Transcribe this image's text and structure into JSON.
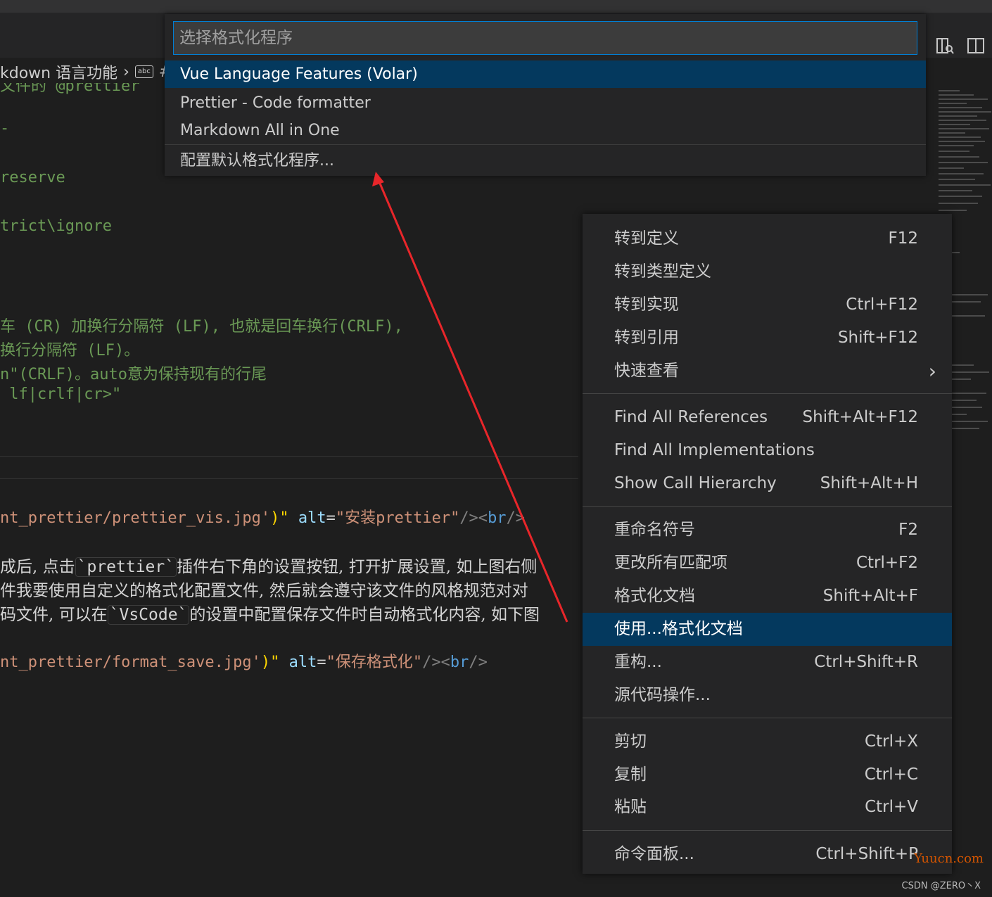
{
  "breadcrumb": {
    "item": "kdown 语言功能",
    "abc_badge": "abc",
    "hash": "#"
  },
  "editor": {
    "lines": [
      {
        "text": "文件的 @prettier",
        "cls": "green"
      },
      {
        "text": "-",
        "cls": "green"
      },
      {
        "text": "reserve",
        "cls": "green"
      },
      {
        "text": "trict\\ignore",
        "cls": "green"
      },
      {
        "text": "车 (CR) 加换行分隔符 (LF), 也就是回车换行(CRLF),",
        "cls": "green"
      },
      {
        "text": "换行分隔符 (LF)。",
        "cls": "green"
      },
      {
        "text": "n\"(CRLF)。auto意为保持现有的行尾",
        "cls": "green"
      },
      {
        "text": " lf|crlf|cr>\"",
        "cls": "green"
      }
    ],
    "img1": {
      "path": "nt_prettier/prettier_vis.jpg'",
      "close": ")\"",
      "attr": "alt",
      "eq": "=",
      "val": "\"安装prettier\"",
      "tail_open": "/><",
      "br": "br",
      "tail_close": "/>"
    },
    "prose1": {
      "a": "成后, 点击",
      "code1": "`prettier`",
      "b": "插件右下角的设置按钮, 打开扩展设置, 如上图右侧"
    },
    "prose2": "件我要使用自定义的格式化配置文件, 然后就会遵守该文件的风格规范对对",
    "prose3": {
      "a": "码文件, 可以在",
      "code2": "`VsCode`",
      "b": "的设置中配置保存文件时自动格式化内容, 如下图"
    },
    "img2": {
      "path": "nt_prettier/format_save.jpg'",
      "close": ")\"",
      "attr": "alt",
      "eq": "=",
      "val": "\"保存格式化\"",
      "tail_open": "/><",
      "br": "br",
      "tail_close": "/>"
    }
  },
  "quick_pick": {
    "placeholder": "选择格式化程序",
    "items": [
      {
        "label": "Vue Language Features (Volar)",
        "selected": true
      },
      {
        "label": "Prettier - Code formatter",
        "selected": false
      },
      {
        "label": "Markdown All in One",
        "selected": false
      },
      {
        "label": "配置默认格式化程序...",
        "selected": false
      }
    ]
  },
  "context_menu": {
    "items": [
      {
        "label": "转到定义",
        "key": "F12"
      },
      {
        "label": "转到类型定义",
        "key": ""
      },
      {
        "label": "转到实现",
        "key": "Ctrl+F12"
      },
      {
        "label": "转到引用",
        "key": "Shift+F12"
      },
      {
        "label": "快速查看",
        "key": "›"
      },
      {
        "label": "Find All References",
        "key": "Shift+Alt+F12"
      },
      {
        "label": "Find All Implementations",
        "key": ""
      },
      {
        "label": "Show Call Hierarchy",
        "key": "Shift+Alt+H"
      },
      {
        "label": "重命名符号",
        "key": "F2"
      },
      {
        "label": "更改所有匹配项",
        "key": "Ctrl+F2"
      },
      {
        "label": "格式化文档",
        "key": "Shift+Alt+F"
      },
      {
        "label": "使用...格式化文档",
        "key": "",
        "selected": true
      },
      {
        "label": "重构...",
        "key": "Ctrl+Shift+R"
      },
      {
        "label": "源代码操作...",
        "key": ""
      },
      {
        "label": "剪切",
        "key": "Ctrl+X"
      },
      {
        "label": "复制",
        "key": "Ctrl+C"
      },
      {
        "label": "粘贴",
        "key": "Ctrl+V"
      },
      {
        "label": "命令面板...",
        "key": "Ctrl+Shift+P"
      }
    ]
  },
  "annotation": {
    "arrow_color": "#e8262a"
  },
  "watermarks": {
    "site": "Yuucn.com",
    "author": "CSDN @ZERO丶X"
  },
  "colors": {
    "selection": "#04395e",
    "focus_border": "#007fd4",
    "menu_bg": "#252526",
    "editor_bg": "#1e1e1e"
  }
}
